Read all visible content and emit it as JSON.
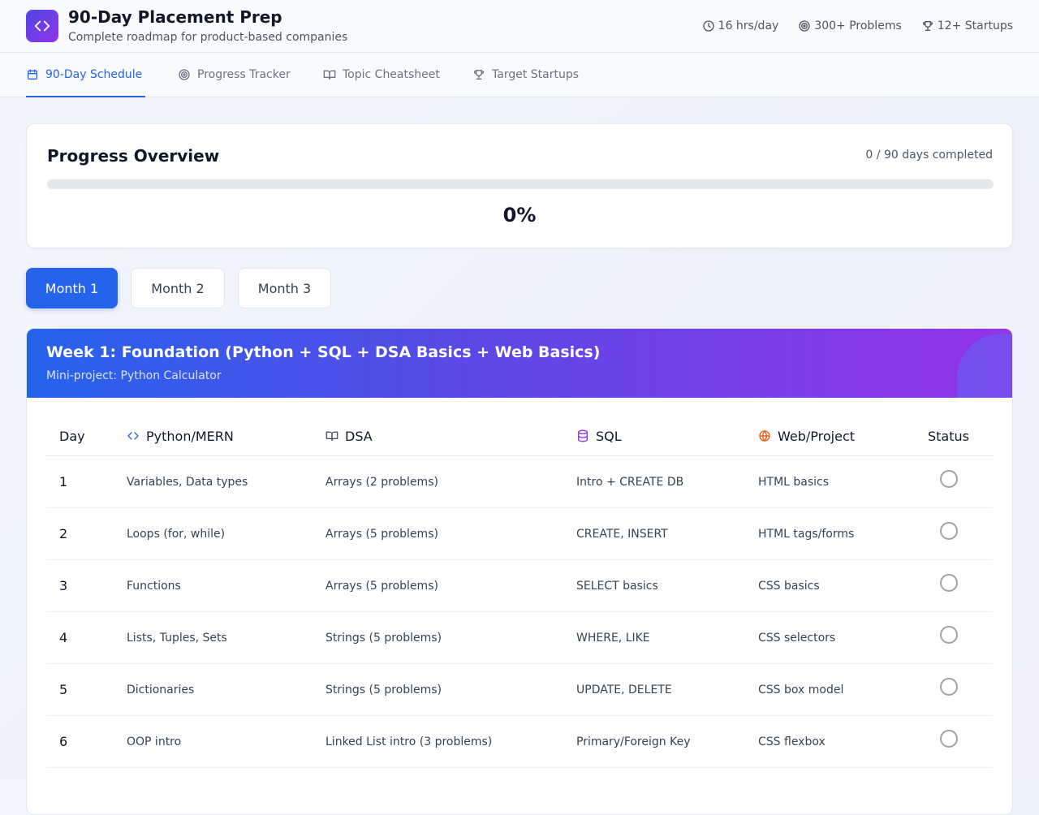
{
  "app": {
    "title": "90-Day Placement Prep",
    "subtitle": "Complete roadmap for product-based companies",
    "logo_icon": "code-icon",
    "accent": "#2563eb"
  },
  "stats": [
    {
      "icon": "clock-icon",
      "label": "16 hrs/day"
    },
    {
      "icon": "target-icon",
      "label": "300+ Problems"
    },
    {
      "icon": "trophy-icon",
      "label": "12+ Startups"
    }
  ],
  "tabs": [
    {
      "icon": "calendar-icon",
      "label": "90-Day Schedule",
      "active": true
    },
    {
      "icon": "target-icon",
      "label": "Progress Tracker",
      "active": false
    },
    {
      "icon": "book-icon",
      "label": "Topic Cheatsheet",
      "active": false
    },
    {
      "icon": "trophy-icon",
      "label": "Target Startups",
      "active": false
    }
  ],
  "progress": {
    "title": "Progress Overview",
    "count_text": "0 / 90 days completed",
    "percent_text": "0%",
    "fraction": 0
  },
  "months": [
    {
      "label": "Month 1",
      "active": true
    },
    {
      "label": "Month 2",
      "active": false
    },
    {
      "label": "Month 3",
      "active": false
    }
  ],
  "week": {
    "title": "Week 1: Foundation (Python + SQL + DSA Basics + Web Basics)",
    "subtitle": "Mini-project: Python Calculator",
    "columns": {
      "day": "Day",
      "python": "Python/MERN",
      "dsa": "DSA",
      "sql": "SQL",
      "web": "Web/Project",
      "status": "Status"
    },
    "rows": [
      {
        "day": "1",
        "python": "Variables, Data types",
        "dsa": "Arrays (2 problems)",
        "sql": "Intro + CREATE DB",
        "web": "HTML basics",
        "done": false
      },
      {
        "day": "2",
        "python": "Loops (for, while)",
        "dsa": "Arrays (5 problems)",
        "sql": "CREATE, INSERT",
        "web": "HTML tags/forms",
        "done": false
      },
      {
        "day": "3",
        "python": "Functions",
        "dsa": "Arrays (5 problems)",
        "sql": "SELECT basics",
        "web": "CSS basics",
        "done": false
      },
      {
        "day": "4",
        "python": "Lists, Tuples, Sets",
        "dsa": "Strings (5 problems)",
        "sql": "WHERE, LIKE",
        "web": "CSS selectors",
        "done": false
      },
      {
        "day": "5",
        "python": "Dictionaries",
        "dsa": "Strings (5 problems)",
        "sql": "UPDATE, DELETE",
        "web": "CSS box model",
        "done": false
      },
      {
        "day": "6",
        "python": "OOP intro",
        "dsa": "Linked List intro (3 problems)",
        "sql": "Primary/Foreign Key",
        "web": "CSS flexbox",
        "done": false
      }
    ]
  }
}
